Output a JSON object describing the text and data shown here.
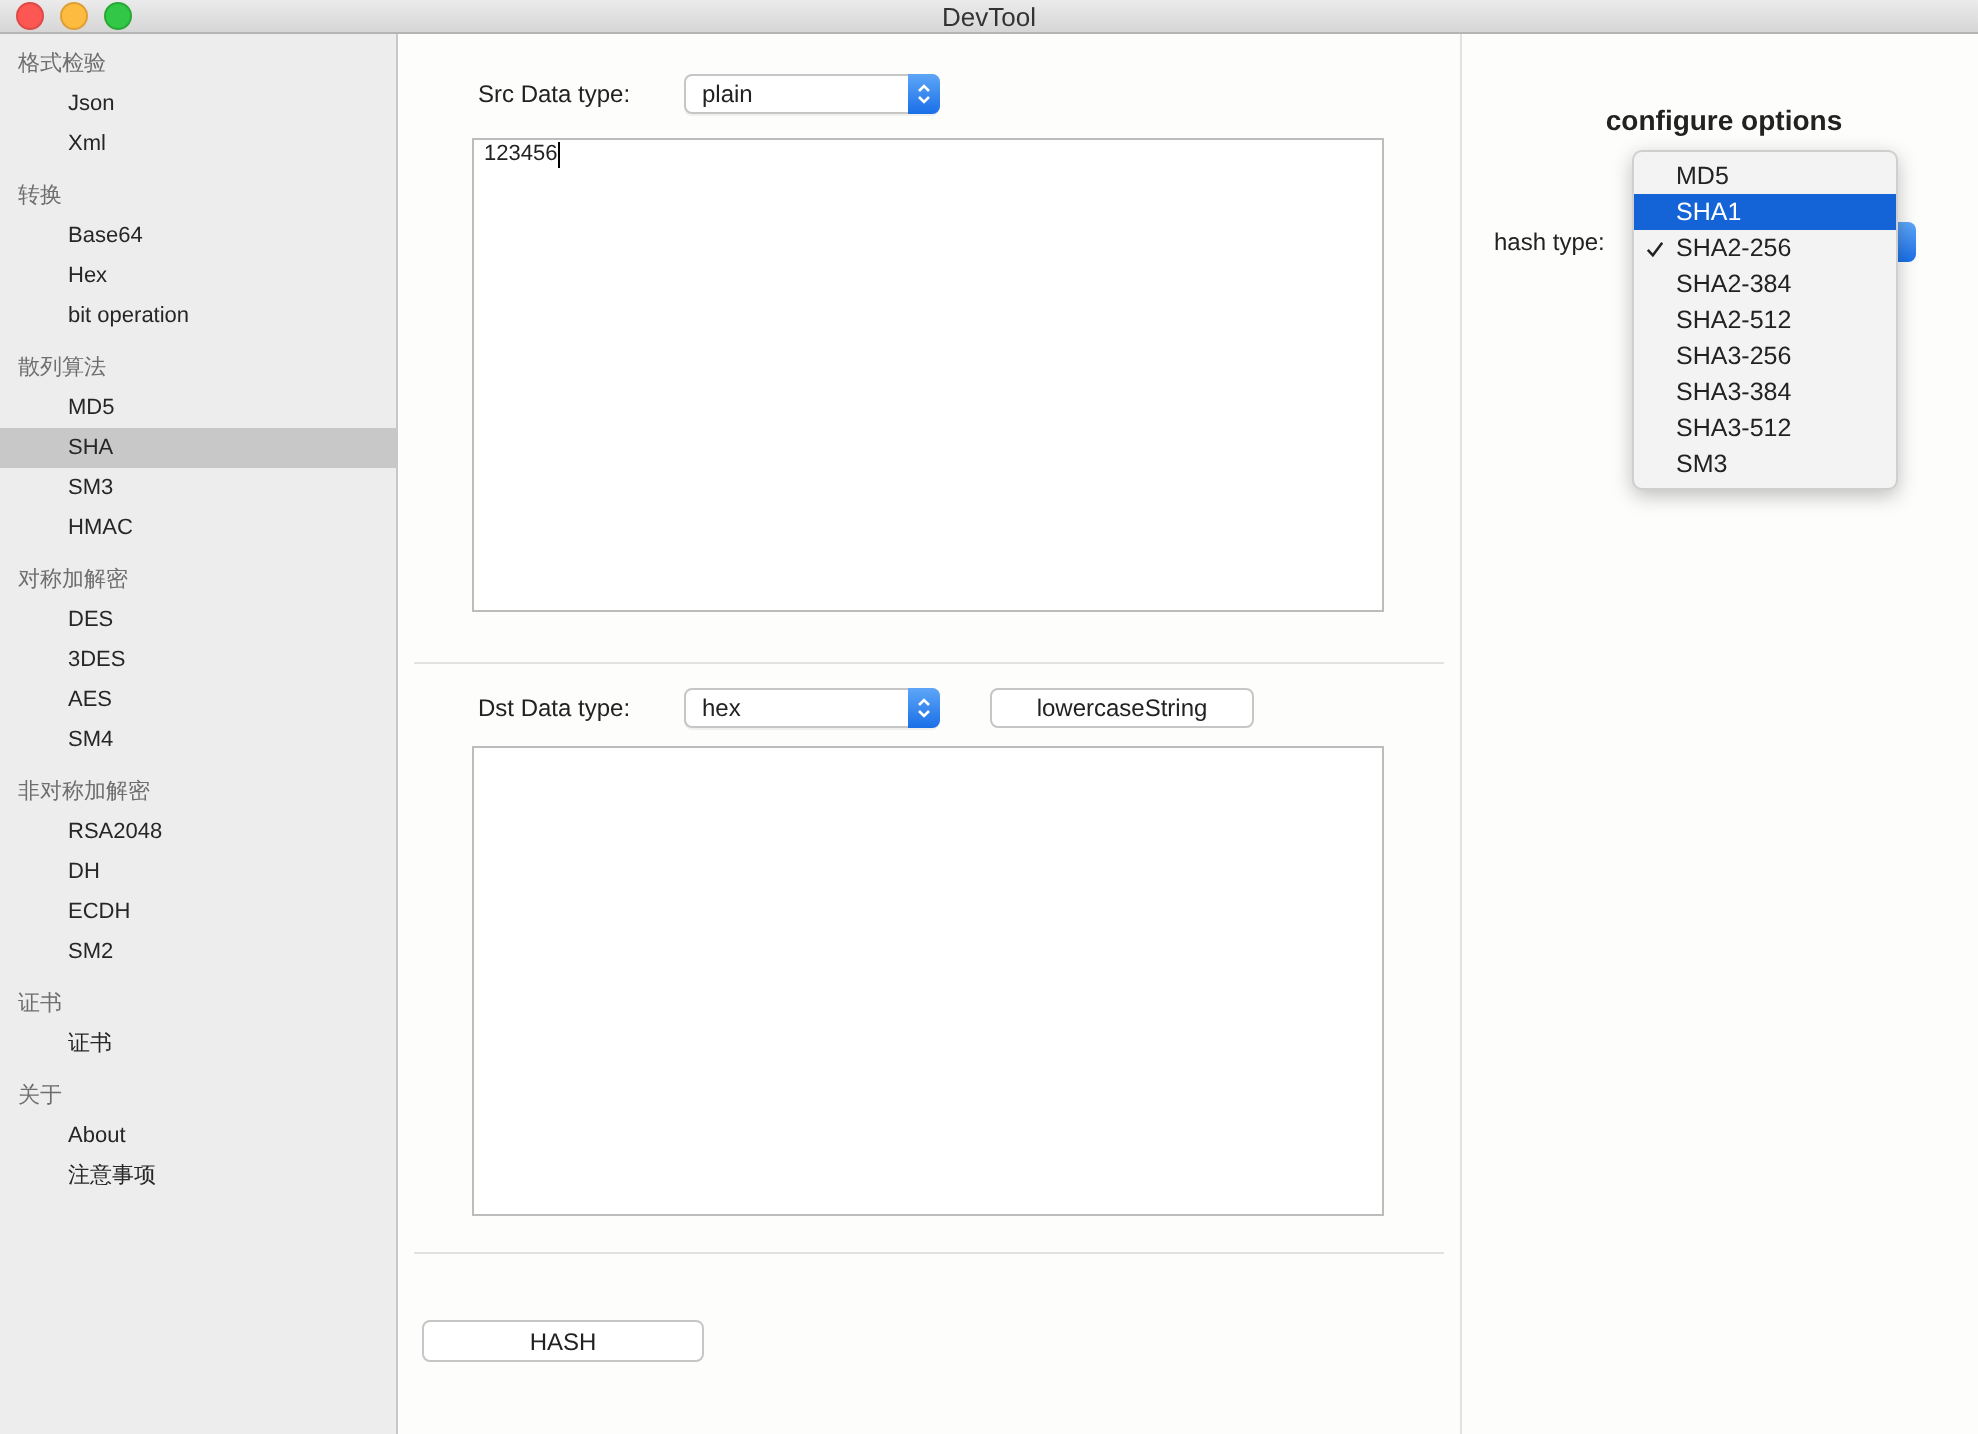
{
  "window": {
    "title": "DevTool"
  },
  "sidebar": {
    "groups": [
      {
        "title": "格式检验",
        "items": [
          {
            "label": "Json",
            "selected": false
          },
          {
            "label": "Xml",
            "selected": false
          }
        ]
      },
      {
        "title": "转换",
        "items": [
          {
            "label": "Base64",
            "selected": false
          },
          {
            "label": "Hex",
            "selected": false
          },
          {
            "label": "bit operation",
            "selected": false
          }
        ]
      },
      {
        "title": "散列算法",
        "items": [
          {
            "label": "MD5",
            "selected": false
          },
          {
            "label": "SHA",
            "selected": true
          },
          {
            "label": "SM3",
            "selected": false
          },
          {
            "label": "HMAC",
            "selected": false
          }
        ]
      },
      {
        "title": "对称加解密",
        "items": [
          {
            "label": "DES",
            "selected": false
          },
          {
            "label": "3DES",
            "selected": false
          },
          {
            "label": "AES",
            "selected": false
          },
          {
            "label": "SM4",
            "selected": false
          }
        ]
      },
      {
        "title": "非对称加解密",
        "items": [
          {
            "label": "RSA2048",
            "selected": false
          },
          {
            "label": "DH",
            "selected": false
          },
          {
            "label": "ECDH",
            "selected": false
          },
          {
            "label": "SM2",
            "selected": false
          }
        ]
      },
      {
        "title": "证书",
        "items": [
          {
            "label": "证书",
            "selected": false
          }
        ]
      },
      {
        "title": "关于",
        "items": [
          {
            "label": "About",
            "selected": false
          },
          {
            "label": "注意事项",
            "selected": false
          }
        ]
      }
    ]
  },
  "source": {
    "label": "Src Data type:",
    "type": "plain",
    "value": "123456"
  },
  "destination": {
    "label": "Dst Data type:",
    "type": "hex",
    "case_button": "lowercaseString"
  },
  "action_button": "HASH",
  "options": {
    "title": "configure options",
    "hash_label": "hash type:",
    "menu": [
      {
        "label": "MD5",
        "selected": false,
        "checked": false
      },
      {
        "label": "SHA1",
        "selected": true,
        "checked": false
      },
      {
        "label": "SHA2-256",
        "selected": false,
        "checked": true
      },
      {
        "label": "SHA2-384",
        "selected": false,
        "checked": false
      },
      {
        "label": "SHA2-512",
        "selected": false,
        "checked": false
      },
      {
        "label": "SHA3-256",
        "selected": false,
        "checked": false
      },
      {
        "label": "SHA3-384",
        "selected": false,
        "checked": false
      },
      {
        "label": "SHA3-512",
        "selected": false,
        "checked": false
      },
      {
        "label": "SM3",
        "selected": false,
        "checked": false
      }
    ]
  }
}
